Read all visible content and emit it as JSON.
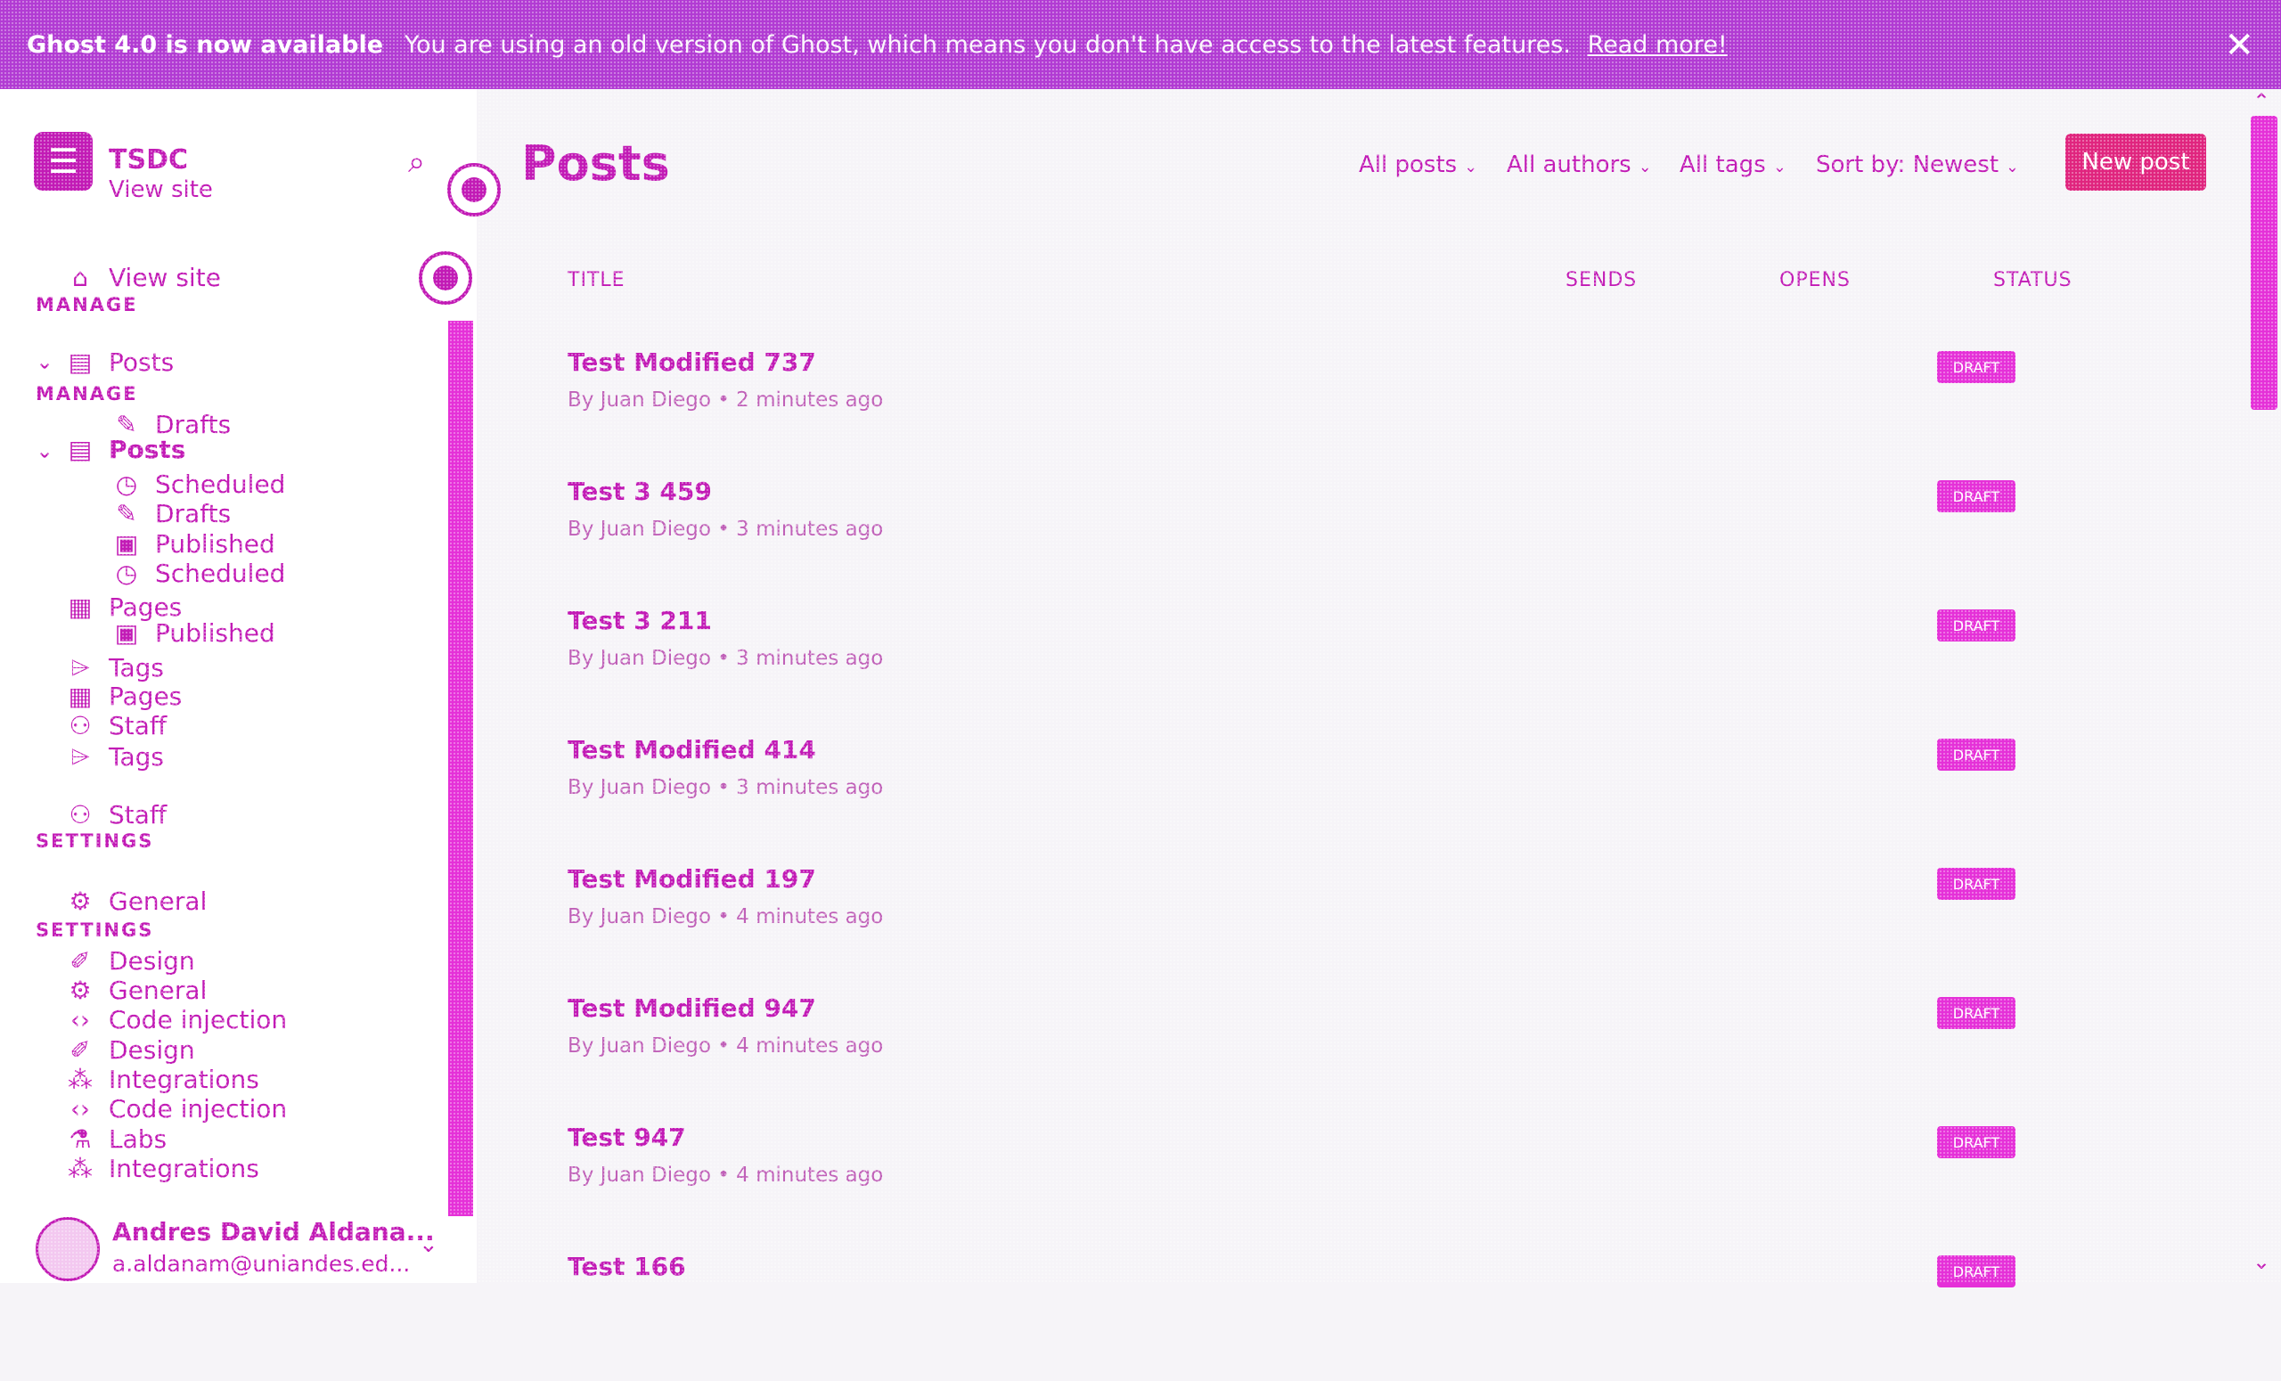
{
  "banner": {
    "title": "Ghost 4.0 is now available",
    "message": "You are using an old version of Ghost, which means you don't have access to the latest features.",
    "link": "Read more!",
    "close_icon": "close-icon"
  },
  "brand": {
    "title": "TSDC",
    "subtitle": "View site"
  },
  "nav": {
    "view_site": "View site",
    "manage_label": "MANAGE",
    "posts": "Posts",
    "drafts": "Drafts",
    "scheduled": "Scheduled",
    "published": "Published",
    "pages": "Pages",
    "tags": "Tags",
    "staff": "Staff",
    "settings_label": "SETTINGS",
    "general": "General",
    "design": "Design",
    "code_injection": "Code injection",
    "integrations": "Integrations",
    "labs": "Labs"
  },
  "user": {
    "name": "Andres David Aldana...",
    "email": "a.aldanam@uniandes.ed..."
  },
  "main": {
    "title": "Posts",
    "filters": [
      "All posts",
      "All authors",
      "All tags",
      "Sort by: Newest"
    ],
    "new_post": "New post",
    "columns": {
      "title": "TITLE",
      "sends": "SENDS",
      "opens": "OPENS",
      "status": "STATUS"
    }
  },
  "posts": [
    {
      "title": "Test Modified 737",
      "meta": "By Juan Diego • 2 minutes ago",
      "status": "Draft"
    },
    {
      "title": "Test 3 459",
      "meta": "By Juan Diego • 3 minutes ago",
      "status": "Draft"
    },
    {
      "title": "Test 3 211",
      "meta": "By Juan Diego • 3 minutes ago",
      "status": "Draft"
    },
    {
      "title": "Test Modified 414",
      "meta": "By Juan Diego • 3 minutes ago",
      "status": "Draft"
    },
    {
      "title": "Test Modified 197",
      "meta": "By Juan Diego • 4 minutes ago",
      "status": "Draft"
    },
    {
      "title": "Test Modified 947",
      "meta": "By Juan Diego • 4 minutes ago",
      "status": "Draft"
    },
    {
      "title": "Test 947",
      "meta": "By Juan Diego • 4 minutes ago",
      "status": "Draft"
    },
    {
      "title": "Test 166",
      "meta": "",
      "status": "Draft"
    }
  ]
}
